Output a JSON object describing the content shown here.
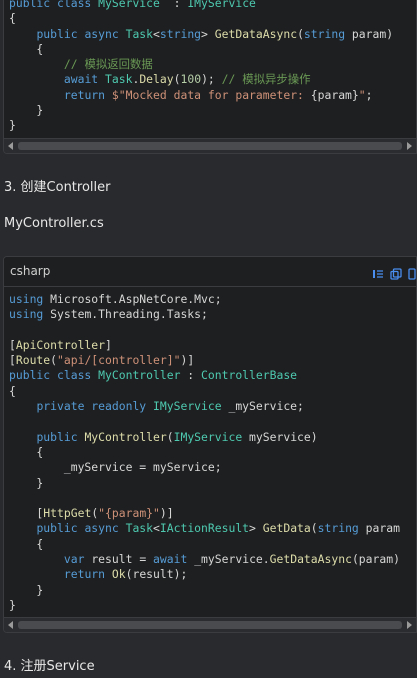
{
  "block1": {
    "lines": [
      [
        [
          "kw",
          "public class "
        ],
        [
          "ty",
          "MyService"
        ],
        [
          "",
          "  : "
        ],
        [
          "ty",
          "IMyService"
        ]
      ],
      [
        [
          "",
          "{"
        ]
      ],
      [
        [
          "",
          "    "
        ],
        [
          "kw",
          "public async "
        ],
        [
          "ty",
          "Task"
        ],
        [
          "",
          "<"
        ],
        [
          "kw",
          "string"
        ],
        [
          "",
          "> "
        ],
        [
          "fn",
          "GetDataAsync"
        ],
        [
          "",
          "("
        ],
        [
          "kw",
          "string"
        ],
        [
          "",
          " param)"
        ]
      ],
      [
        [
          "",
          "    {"
        ]
      ],
      [
        [
          "",
          "        "
        ],
        [
          "cm",
          "// 模拟返回数据"
        ]
      ],
      [
        [
          "",
          "        "
        ],
        [
          "kw",
          "await "
        ],
        [
          "ty",
          "Task"
        ],
        [
          "",
          "."
        ],
        [
          "fn",
          "Delay"
        ],
        [
          "",
          "("
        ],
        [
          "num",
          "100"
        ],
        [
          "",
          "); "
        ],
        [
          "cm",
          "// 模拟异步操作"
        ]
      ],
      [
        [
          "",
          "        "
        ],
        [
          "kw",
          "return "
        ],
        [
          "str",
          "$\"Mocked data for parameter: "
        ],
        [
          "",
          "{param}"
        ],
        [
          "str",
          "\""
        ],
        [
          "",
          ";"
        ]
      ],
      [
        [
          "",
          "    }"
        ]
      ],
      [
        [
          "",
          "}"
        ]
      ]
    ]
  },
  "step3": {
    "label": "3. 创建Controller"
  },
  "filename": {
    "label": "MyController.cs"
  },
  "block2": {
    "language": "csharp",
    "icons": [
      "insert-code-icon",
      "copy-icon",
      "more-icon"
    ],
    "lines": [
      [
        [
          "kw",
          "using "
        ],
        [
          "",
          "Microsoft.AspNetCore.Mvc;"
        ]
      ],
      [
        [
          "kw",
          "using "
        ],
        [
          "",
          "System.Threading.Tasks;"
        ]
      ],
      [
        [
          "",
          ""
        ]
      ],
      [
        [
          "",
          "["
        ],
        [
          "at",
          "ApiController"
        ],
        [
          "",
          "]"
        ]
      ],
      [
        [
          "",
          "["
        ],
        [
          "at",
          "Route"
        ],
        [
          "",
          "("
        ],
        [
          "str",
          "\"api/[controller]\""
        ],
        [
          "",
          ")]"
        ]
      ],
      [
        [
          "kw",
          "public class "
        ],
        [
          "ty",
          "MyController"
        ],
        [
          "",
          " : "
        ],
        [
          "ty",
          "ControllerBase"
        ]
      ],
      [
        [
          "",
          "{"
        ]
      ],
      [
        [
          "",
          "    "
        ],
        [
          "kw",
          "private readonly "
        ],
        [
          "ty",
          "IMyService"
        ],
        [
          "",
          " _myService;"
        ]
      ],
      [
        [
          "",
          ""
        ]
      ],
      [
        [
          "",
          "    "
        ],
        [
          "kw",
          "public "
        ],
        [
          "fn",
          "MyController"
        ],
        [
          "",
          "("
        ],
        [
          "ty",
          "IMyService"
        ],
        [
          "",
          " myService)"
        ]
      ],
      [
        [
          "",
          "    {"
        ]
      ],
      [
        [
          "",
          "        _myService = myService;"
        ]
      ],
      [
        [
          "",
          "    }"
        ]
      ],
      [
        [
          "",
          ""
        ]
      ],
      [
        [
          "",
          "    ["
        ],
        [
          "at",
          "HttpGet"
        ],
        [
          "",
          "("
        ],
        [
          "str",
          "\"{param}\""
        ],
        [
          "",
          ")]"
        ]
      ],
      [
        [
          "",
          "    "
        ],
        [
          "kw",
          "public async "
        ],
        [
          "ty",
          "Task"
        ],
        [
          "",
          "<"
        ],
        [
          "ty",
          "IActionResult"
        ],
        [
          "",
          "> "
        ],
        [
          "fn",
          "GetData"
        ],
        [
          "",
          "("
        ],
        [
          "kw",
          "string"
        ],
        [
          "",
          " param"
        ]
      ],
      [
        [
          "",
          "    {"
        ]
      ],
      [
        [
          "",
          "        "
        ],
        [
          "kw",
          "var "
        ],
        [
          "",
          "result = "
        ],
        [
          "kw",
          "await "
        ],
        [
          "",
          "_myService."
        ],
        [
          "fn",
          "GetDataAsync"
        ],
        [
          "",
          "(param)"
        ]
      ],
      [
        [
          "",
          "        "
        ],
        [
          "kw",
          "return "
        ],
        [
          "fn",
          "Ok"
        ],
        [
          "",
          "(result);"
        ]
      ],
      [
        [
          "",
          "    }"
        ]
      ],
      [
        [
          "",
          "}"
        ]
      ]
    ]
  },
  "step4": {
    "label": "4. 注册Service"
  }
}
